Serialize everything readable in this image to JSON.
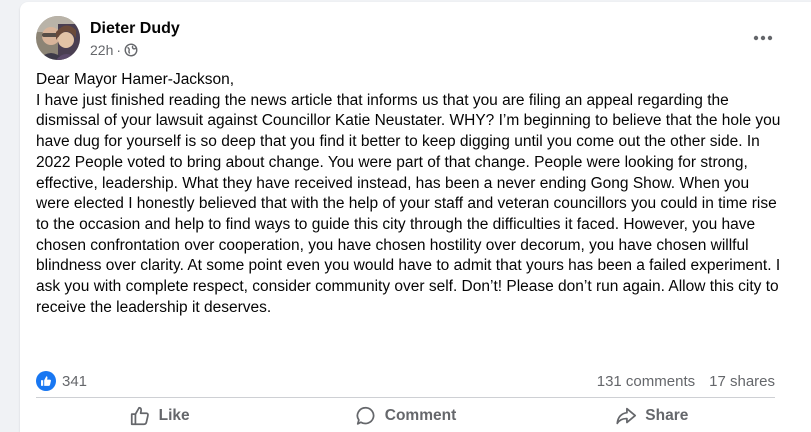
{
  "post": {
    "author": "Dieter Dudy",
    "time": "22h",
    "separator": "·",
    "audience_icon": "globe-icon",
    "more_icon": "more-options-icon",
    "body": {
      "greeting": "Dear Mayor Hamer-Jackson,",
      "text": "I have just finished reading the news article that informs us that you are filing an appeal regarding the dismissal of your lawsuit against Councillor Katie Neustater. WHY? I’m beginning to believe that the hole you have dug for yourself is so deep that you find it better to keep digging until you come out the other side. In 2022 People voted to bring about change. You were part of that change. People were looking for strong, effective, leadership. What they have received instead, has been a never ending Gong Show. When you were elected I honestly believed that with the help of your staff and veteran councillors you could in time rise to the occasion and help to find ways to guide this city through the difficulties it faced. However, you have chosen confrontation over cooperation, you have chosen hostility over decorum, you have chosen willful blindness over clarity. At some point even you would have to admit that yours has been a failed experiment. I ask you with complete respect, consider community over self. Don’t! Please don’t run again. Allow this city to receive the leadership it deserves."
    }
  },
  "stats": {
    "reaction_icon": "like-reaction-icon",
    "reactions": "341",
    "comments": "131 comments",
    "shares": "17 shares"
  },
  "actions": {
    "like": {
      "label": "Like",
      "icon": "thumbs-up-icon"
    },
    "comment": {
      "label": "Comment",
      "icon": "comment-icon"
    },
    "share": {
      "label": "Share",
      "icon": "share-icon"
    }
  },
  "colors": {
    "text_primary": "#050505",
    "text_secondary": "#65676b",
    "like_blue": "#1877f2",
    "divider": "#ced0d4",
    "page_background": "#f0f2f5"
  }
}
